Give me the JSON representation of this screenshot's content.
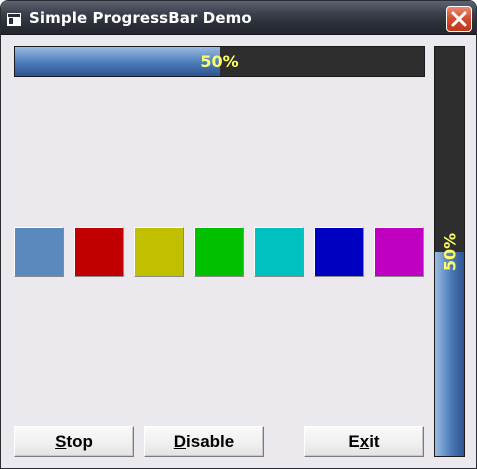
{
  "window": {
    "title": "Simple ProgressBar Demo",
    "icon": "app-window-icon",
    "close_icon": "close-icon"
  },
  "progress": {
    "horizontal": {
      "value": 50,
      "label": "50%"
    },
    "vertical": {
      "value": 50,
      "label": "50%"
    },
    "fill_color": "#4d7bb8",
    "track_color": "#2e2e2e",
    "text_color": "#ffff66"
  },
  "swatches": [
    {
      "name": "steel-blue",
      "color": "#5a89c0"
    },
    {
      "name": "red",
      "color": "#c00000"
    },
    {
      "name": "olive-yellow",
      "color": "#c0c000"
    },
    {
      "name": "green",
      "color": "#00c000"
    },
    {
      "name": "cyan",
      "color": "#00c0c0"
    },
    {
      "name": "blue",
      "color": "#0000c0"
    },
    {
      "name": "magenta",
      "color": "#c000c0"
    }
  ],
  "buttons": {
    "stop": {
      "mnemonic": "S",
      "rest": "top"
    },
    "disable": {
      "mnemonic": "D",
      "rest": "isable"
    },
    "exit": {
      "before": "E",
      "mnemonic": "x",
      "rest": "it"
    }
  }
}
